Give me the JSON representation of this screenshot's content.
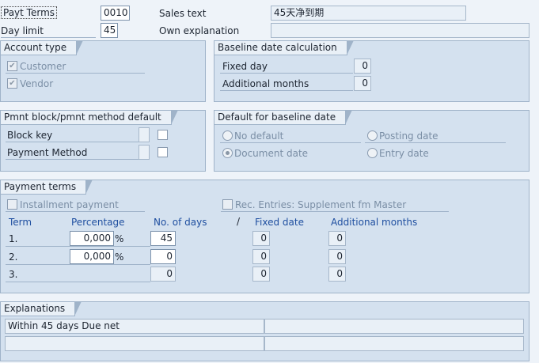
{
  "header": {
    "payt_terms_label": "Payt Terms",
    "payt_terms_value": "0010",
    "sales_text_label": "Sales text",
    "sales_text_value": "45天净到期",
    "day_limit_label": "Day limit",
    "day_limit_value": "45",
    "own_explanation_label": "Own explanation",
    "own_explanation_value": ""
  },
  "account_type": {
    "title": "Account type",
    "customer": "Customer",
    "vendor": "Vendor"
  },
  "baseline_calc": {
    "title": "Baseline date calculation",
    "fixed_day_label": "Fixed day",
    "fixed_day_value": "0",
    "additional_months_label": "Additional months",
    "additional_months_value": "0"
  },
  "pmnt_block": {
    "title": "Pmnt block/pmnt method default",
    "block_key_label": "Block key",
    "payment_method_label": "Payment Method"
  },
  "default_baseline": {
    "title": "Default for baseline date",
    "no_default": "No default",
    "posting_date": "Posting date",
    "document_date": "Document date",
    "entry_date": "Entry date"
  },
  "payment_terms": {
    "title": "Payment terms",
    "installment_payment": "Installment payment",
    "rec_entries": "Rec. Entries: Supplement fm Master",
    "columns": {
      "term": "Term",
      "percentage": "Percentage",
      "no_of_days": "No. of days",
      "slash": "/",
      "fixed_date": "Fixed date",
      "additional_months": "Additional months"
    },
    "rows": [
      {
        "term": "1.",
        "percentage": "0,000",
        "pct_sign": "%",
        "days": "45",
        "fixed_date": "0",
        "additional_months": "0"
      },
      {
        "term": "2.",
        "percentage": "0,000",
        "pct_sign": "%",
        "days": "0",
        "fixed_date": "0",
        "additional_months": "0"
      },
      {
        "term": "3.",
        "days": "0",
        "fixed_date": "0",
        "additional_months": "0"
      }
    ]
  },
  "explanations": {
    "title": "Explanations",
    "line1": "Within 45 days Due net"
  },
  "colors": {
    "background": "#eef3f9",
    "panel": "#d4e1ef",
    "header_text": "#1f4fa0"
  },
  "icons": {
    "checkmark": "checkmark-icon"
  }
}
